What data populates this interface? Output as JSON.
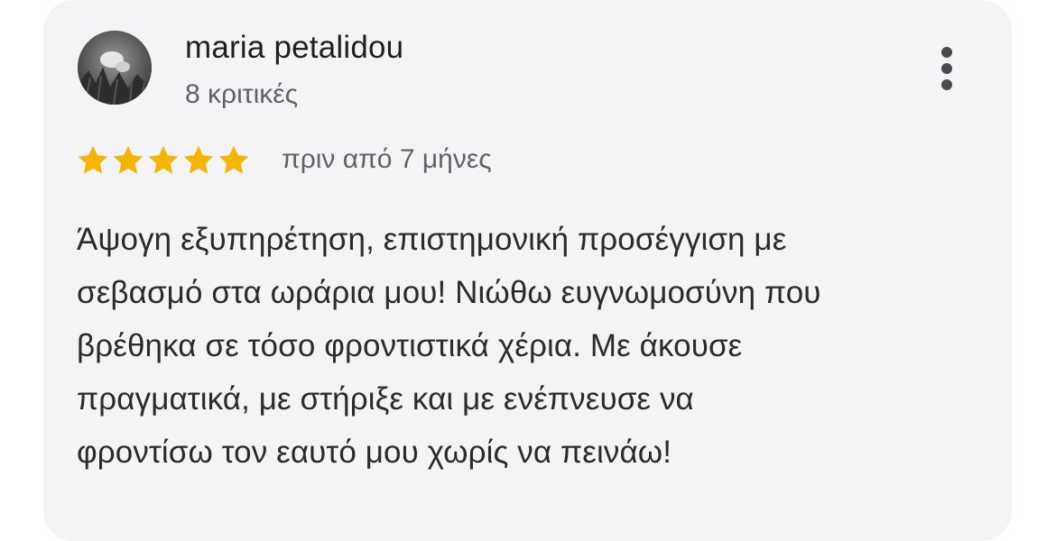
{
  "review": {
    "author_name": "maria petalidou",
    "review_count": "8 κριτικές",
    "rating": 5,
    "rating_max": 5,
    "time_ago": "πριν από 7 μήνες",
    "text_lines": [
      "Άψογη εξυπηρέτηση, επιστημονική προσέγγιση με",
      "σεβασμό στα ωράρια μου! Νιώθω ευγνωμοσύνη που",
      "βρέθηκα σε τόσο φροντιστικά χέρια. Με άκουσε",
      "πραγματικά, με στήριξε και με ενέπνευσε να",
      "φροντίσω τον εαυτό μου χωρίς να πεινάω!"
    ]
  },
  "icons": {
    "avatar": "avatar-photo",
    "more": "more-vertical-icon",
    "star": "star-icon"
  },
  "colors": {
    "card_background": "#f4f4f6",
    "star": "#f5b400",
    "author_text": "#1f1f1f",
    "secondary_text": "#5f6368",
    "menu_dots": "#4a4a4f"
  }
}
